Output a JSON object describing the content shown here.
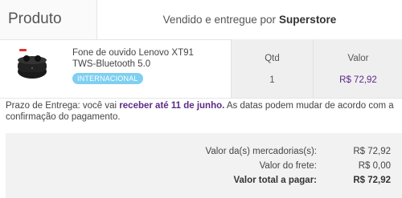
{
  "header": {
    "product_label": "Produto",
    "sold_by_text": "Vendido e entregue por",
    "store_name": "Superstore"
  },
  "product": {
    "name": "Fone de ouvido Lenovo XT91 TWS-Bluetooth 5.0",
    "badge": "INTERNACIONAL",
    "qty_header": "Qtd",
    "qty": "1",
    "price_header": "Valor",
    "price": "R$ 72,92",
    "image_icon": "earbuds-case-icon"
  },
  "delivery": {
    "prefix": "Prazo de Entrega: você vai",
    "highlight": "receber até 11 de junho.",
    "suffix": "As datas podem mudar de acordo com a confirmação do pagamento."
  },
  "totals": {
    "items_label": "Valor da(s) mercadorias(s):",
    "items_value": "R$ 72,92",
    "shipping_label": "Valor do frete:",
    "shipping_value": "R$ 0,00",
    "total_label": "Valor total a pagar:",
    "total_value": "R$ 72,92"
  },
  "colors": {
    "accent_purple": "#5b2a86",
    "badge_blue": "#7ecff0",
    "panel_gray": "#efefef"
  }
}
